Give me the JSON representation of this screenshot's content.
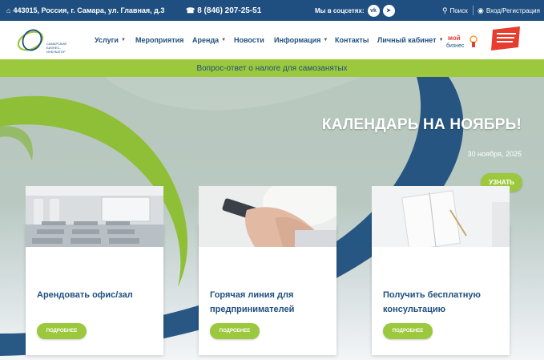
{
  "topbar": {
    "address": "443015, Россия, г. Самара, ул. Главная, д.3",
    "phone": "8 (846) 207-25-51",
    "social_label": "Мы в соцсетях:",
    "social_icons": [
      "vk-icon",
      "telegram-icon"
    ],
    "search_label": "Поиск",
    "login_label": "Вход/Регистрация"
  },
  "nav": {
    "logo_text": "САМАРСКИЙ БИЗНЕС-ИНКУБАТОР",
    "items": [
      {
        "label": "Услуги",
        "dropdown": true
      },
      {
        "label": "Мероприятия",
        "dropdown": false
      },
      {
        "label": "Аренда",
        "dropdown": true
      },
      {
        "label": "Новости",
        "dropdown": false
      },
      {
        "label": "Информация",
        "dropdown": true
      },
      {
        "label": "Контакты",
        "dropdown": false
      },
      {
        "label": "Личный кабинет",
        "dropdown": true
      }
    ],
    "mybiz_logo": "мой бизнес",
    "national_project_logo": "НАЦИОНАЛЬНЫЕ ПРОЕКТЫ РОССИИ"
  },
  "announcement": "Вопрос-ответ о налоге для самозанятых",
  "hero": {
    "title": "КАЛЕНДАРЬ НА НОЯБРЬ!",
    "date": "30 ноября, 2025",
    "button_label": "УЗНАТЬ"
  },
  "cards": [
    {
      "title": "Арендовать офис/зал",
      "button_label": "ПОДРОБНЕЕ",
      "photo": "conference-room-photo"
    },
    {
      "title": "Горячая линия для предпринимателей",
      "button_label": "ПОДРОБНЕЕ",
      "photo": "phone-in-hands-photo"
    },
    {
      "title": "Получить бесплатную консультацию",
      "button_label": "ПОДРОБНЕЕ",
      "photo": "notebook-photo"
    }
  ],
  "colors": {
    "brand_blue": "#1f4f80",
    "accent_green": "#9cc83d"
  }
}
